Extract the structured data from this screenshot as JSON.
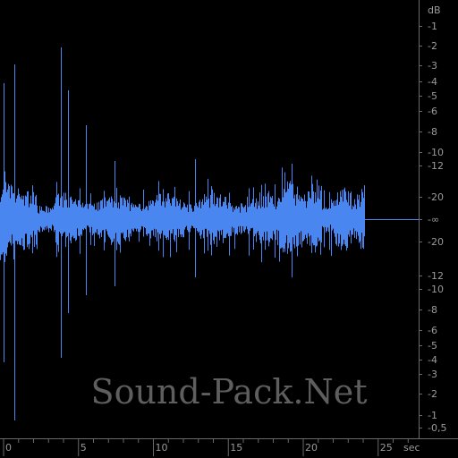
{
  "colors": {
    "background": "#000000",
    "waveform": "#4a86f0",
    "grid_line": "#6a6a6a",
    "label": "#9a9a9a",
    "watermark": "#5e5e5e"
  },
  "db_scale": {
    "unit": "dB",
    "upper_labels": [
      "-1",
      "-2",
      "-3",
      "-4",
      "-5",
      "-6",
      "-8",
      "-10",
      "-12",
      "-20"
    ],
    "center_label": "-∞",
    "lower_labels": [
      "-20",
      "-12",
      "-10",
      "-8",
      "-6",
      "-5",
      "-4",
      "-3",
      "-2",
      "-1",
      "-0,5"
    ]
  },
  "time_axis": {
    "unit": "sec",
    "labels": [
      "0",
      "5",
      "10",
      "15",
      "20",
      "25"
    ]
  },
  "watermark": "Sound-Pack.Net"
}
